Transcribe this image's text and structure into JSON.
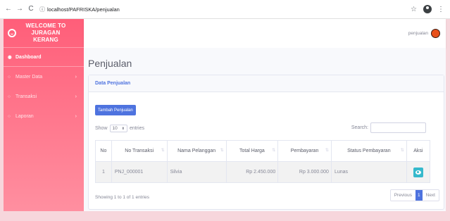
{
  "browser": {
    "url": "localhost/PAFRISKA/penjualan"
  },
  "sidebar": {
    "brand": "WELCOME TO JURAGAN KERANG",
    "items": [
      {
        "label": "Dashboard",
        "icon": "dashboard-icon"
      },
      {
        "label": "Master Data",
        "icon": "circle-icon"
      },
      {
        "label": "Transaksi",
        "icon": "circle-icon"
      },
      {
        "label": "Laporan",
        "icon": "circle-icon"
      }
    ]
  },
  "topbar": {
    "user": "penjualan"
  },
  "main": {
    "title": "Penjualan",
    "card_title": "Data Penjualan",
    "add_button": "Tambah Penjualan",
    "show_label": "Show",
    "length_value": "10",
    "entries_label": "entries",
    "search_label": "Search:",
    "table": {
      "columns": [
        "No",
        "No Transaksi",
        "Nama Pelanggan",
        "Total Harga",
        "Pembayaran",
        "Status Pembayaran",
        "Aksi"
      ],
      "rows": [
        {
          "no": "1",
          "no_transaksi": "PNJ_000001",
          "pelanggan": "Silvia",
          "total": "Rp 2.450.000",
          "pembayaran": "Rp 3.000.000",
          "status": "Lunas"
        }
      ]
    },
    "info": "Showing 1 to 1 of 1 entries",
    "pagination": {
      "previous": "Previous",
      "current": "1",
      "next": "Next"
    }
  },
  "colors": {
    "sidebar": "#ff6f86",
    "primary": "#4e73df",
    "info": "#36b9cc",
    "frame": "#f7d6dc"
  }
}
